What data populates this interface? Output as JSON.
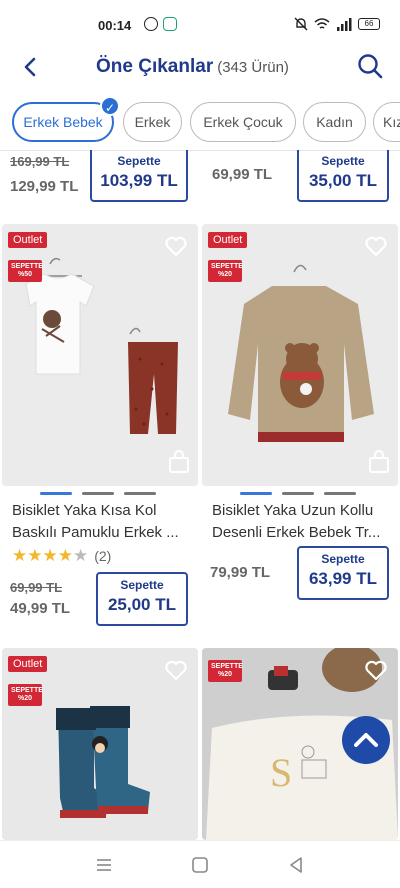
{
  "status": {
    "time": "00:14",
    "battery": "66"
  },
  "header": {
    "title": "Öne Çıkanlar",
    "count": "(343 Ürün)"
  },
  "chips": [
    {
      "label": "Erkek Bebek",
      "active": true
    },
    {
      "label": "Erkek",
      "active": false
    },
    {
      "label": "Erkek Çocuk",
      "active": false
    },
    {
      "label": "Kadın",
      "active": false
    },
    {
      "label": "Kız",
      "active": false
    }
  ],
  "top_row": {
    "left": {
      "old": "169,99 TL",
      "now": "129,99 TL",
      "sepette_label": "Sepette",
      "sepette_value": "103,99 TL"
    },
    "right": {
      "now": "69,99 TL",
      "sepette_label": "Sepette",
      "sepette_value": "35,00 TL"
    }
  },
  "products": [
    {
      "outlet": "Outlet",
      "sepette_badge": "SEPETTE %50",
      "name": "Bisiklet Yaka Kısa Kol Baskılı Pamuklu Erkek ...",
      "stars_full": 4,
      "rating_count": "(2)",
      "old_price": "69,99 TL",
      "price": "49,99 TL",
      "sepette_label": "Sepette",
      "sepette_value": "25,00 TL"
    },
    {
      "outlet": "Outlet",
      "sepette_badge": "SEPETTE %20",
      "name": "Bisiklet Yaka Uzun Kollu Desenli Erkek Bebek Tr...",
      "price": "79,99 TL",
      "sepette_label": "Sepette",
      "sepette_value": "63,99 TL"
    },
    {
      "outlet": "Outlet",
      "sepette_badge": "SEPETTE %20"
    },
    {
      "sepette_badge": "SEPETTE %20"
    }
  ],
  "colors": {
    "brand": "#1f3a8a",
    "accent": "#2b6fd6",
    "badge_red": "#d22735"
  }
}
